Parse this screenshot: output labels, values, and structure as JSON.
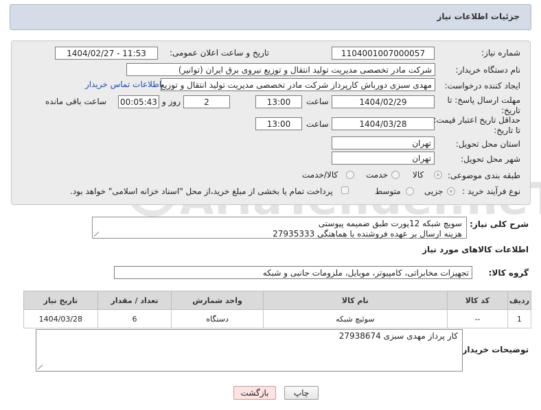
{
  "header": {
    "title": "جزئیات اطلاعات نیاز"
  },
  "form": {
    "need_number_label": "شماره نیاز:",
    "need_number": "1104001007000057",
    "announce_label": "تاریخ و ساعت اعلان عمومی:",
    "announce_value": "1404/02/27 - 11:53",
    "buyer_org_label": "نام دستگاه خریدار:",
    "buyer_org": "شرکت مادر تخصصی مدیریت تولید  انتقال و توزیع نیروی برق ایران (توانیر)",
    "requester_label": "ایجاد کننده درخواست:",
    "requester": "مهدی سبزی دورباش کارپرداز شرکت مادر تخصصی مدیریت تولید  انتقال و توزیع نیروی برق ایران (توانیر)",
    "contact_link": "اطلاعات تماس خریدار",
    "reply_deadline_label_1": "مهلت ارسال پاسخ: تا",
    "reply_deadline_label_2": "تاریخ:",
    "reply_date": "1404/02/29",
    "time_label": "ساعت",
    "reply_time": "13:00",
    "days_value": "2",
    "days_label": "روز و",
    "remaining_time": "00:05:43",
    "remaining_label": "ساعت باقی مانده",
    "price_validity_label_1": "حداقل تاریخ اعتبار قیمت:",
    "price_validity_label_2": "تا تاریخ:",
    "price_date": "1404/03/28",
    "price_time": "13:00",
    "province_label": "استان محل تحویل:",
    "province": "تهران",
    "city_label": "شهر محل تحویل:",
    "city": "تهران",
    "category_label": "طبقه بندی موضوعی:",
    "category_options": [
      "کالا",
      "خدمت",
      "کالا/خدمت"
    ],
    "purchase_type_label": "نوع فرآیند خرید :",
    "purchase_options": [
      "جزیی",
      "متوسط"
    ],
    "payment_note": "پرداخت تمام یا بخشی از مبلغ خرید،از محل \"اسناد خزانه اسلامی\" خواهد بود."
  },
  "summary": {
    "label": "شرح کلی نیاز:",
    "line1": "سویچ شبکه 12پورت طبق  ضمیمه پیوستی",
    "line2": "هزینه ارسال بر عهده فروشنده با هماهنگی 27935333"
  },
  "goods": {
    "section_title": "اطلاعات کالاهای مورد نیاز",
    "group_label": "گروه کالا:",
    "group_value": "تجهیزات مخابراتی، کامپیوتر، موبایل، ملزومات جانبی و شبکه",
    "columns": [
      "ردیف",
      "کد کالا",
      "نام کالا",
      "واحد شمارش",
      "تعداد / مقدار",
      "تاریخ نیاز"
    ],
    "rows": [
      [
        "1",
        "--",
        "سوئیچ شبکه",
        "دستگاه",
        "6",
        "1404/03/28"
      ]
    ]
  },
  "buyer_notes": {
    "label": "توضیحات خریدار:",
    "text": "کار پرداز مهدی سبزی 27938674"
  },
  "buttons": {
    "print": "چاپ",
    "back": "بازگشت"
  },
  "watermark": {
    "text": "AriaTender.neT"
  },
  "colors": {
    "header_bg": "#d4dce7",
    "link": "#1a4fb8",
    "back_button_bg": "#fde3e3"
  }
}
